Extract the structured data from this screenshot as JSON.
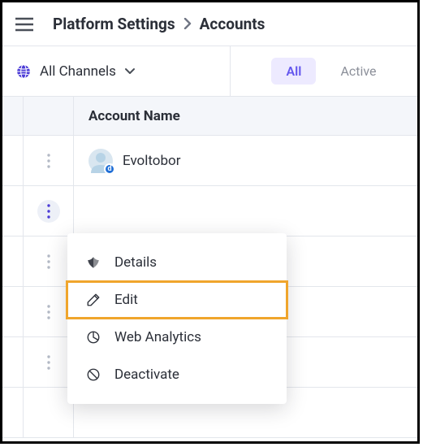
{
  "breadcrumb": {
    "parent": "Platform Settings",
    "current": "Accounts"
  },
  "channel_picker": {
    "label": "All Channels"
  },
  "tabs": {
    "all": "All",
    "active": "Active"
  },
  "table": {
    "header": "Account Name",
    "rows": [
      {
        "name": "Evoltobor",
        "badge": "d"
      }
    ]
  },
  "menu": {
    "details": "Details",
    "edit": "Edit",
    "web_analytics": "Web Analytics",
    "deactivate": "Deactivate"
  }
}
